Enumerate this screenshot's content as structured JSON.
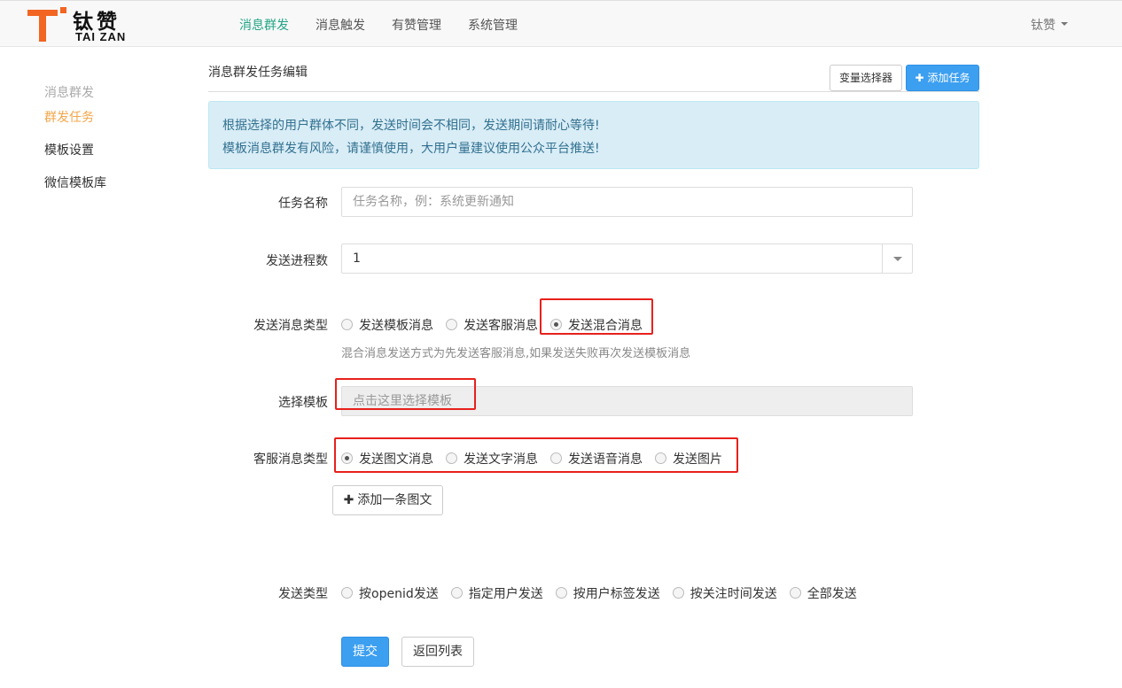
{
  "brand": {
    "cn": "钛赞",
    "en": "TAI ZAN",
    "accent": "#f26522"
  },
  "nav": {
    "items": [
      "消息群发",
      "消息触发",
      "有赞管理",
      "系统管理"
    ],
    "active_color": "#23a587",
    "user": "钛赞"
  },
  "sidebar": {
    "group": "消息群发",
    "items": [
      "群发任务",
      "模板设置",
      "微信模板库"
    ],
    "active_color": "#f3a64a"
  },
  "header": {
    "title": "消息群发任务编辑",
    "variable_btn": "变量选择器",
    "add_task_btn": "添加任务"
  },
  "alert": {
    "line1": "根据选择的用户群体不同，发送时间会不相同，发送期间请耐心等待!",
    "line2": "模板消息群发有风险，请谨慎使用，大用户量建议使用公众平台推送!"
  },
  "form": {
    "task_name": {
      "label": "任务名称",
      "placeholder": "任务名称，例：系统更新通知",
      "value": ""
    },
    "process_count": {
      "label": "发送进程数",
      "value": "1"
    },
    "msg_type": {
      "label": "发送消息类型",
      "options": [
        "发送模板消息",
        "发送客服消息",
        "发送混合消息"
      ],
      "selected": "发送混合消息",
      "help": "混合消息发送方式为先发送客服消息,如果发送失败再次发送模板消息"
    },
    "template": {
      "label": "选择模板",
      "placeholder": "点击这里选择模板"
    },
    "kf_type": {
      "label": "客服消息类型",
      "options": [
        "发送图文消息",
        "发送文字消息",
        "发送语音消息",
        "发送图片"
      ],
      "selected": "发送图文消息"
    },
    "add_news_btn": "添加一条图文",
    "send_type": {
      "label": "发送类型",
      "options": [
        "按openid发送",
        "指定用户发送",
        "按用户标签发送",
        "按关注时间发送",
        "全部发送"
      ]
    },
    "submit_btn": "提交",
    "back_btn": "返回列表"
  },
  "highlight_color": "#e8201c"
}
